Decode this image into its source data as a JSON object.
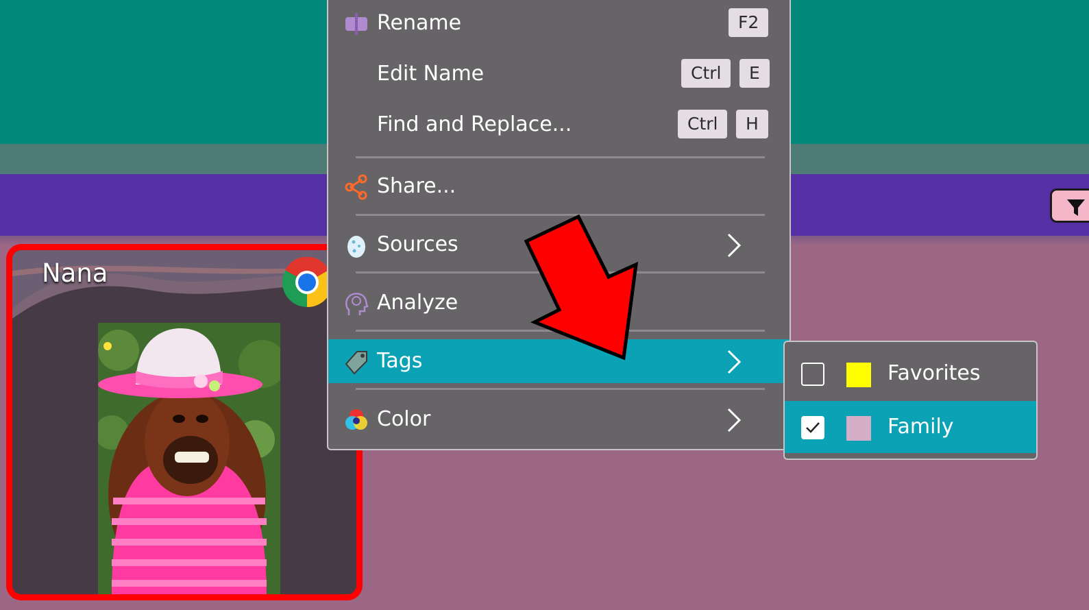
{
  "card": {
    "title": "Nana",
    "frame_color": "#ff0000",
    "browser_icon": "chrome-icon",
    "image": "orangutan-photo"
  },
  "toolbar": {
    "filter_icon": "filter-icon",
    "filter_button_color": "#f4b6c9"
  },
  "context_menu": {
    "items": [
      {
        "label": "Rename",
        "icon": "rename-icon",
        "shortcut": [
          "F2"
        ]
      },
      {
        "label": "Edit Name",
        "shortcut": [
          "Ctrl",
          "E"
        ]
      },
      {
        "label": "Find and Replace...",
        "shortcut": [
          "Ctrl",
          "H"
        ]
      },
      {
        "label": "Share...",
        "icon": "share-icon"
      },
      {
        "label": "Sources",
        "icon": "egg-icon",
        "submenu": true
      },
      {
        "label": "Analyze",
        "icon": "brain-icon"
      },
      {
        "label": "Tags",
        "icon": "tag-icon",
        "submenu": true,
        "highlighted": true
      },
      {
        "label": "Color",
        "icon": "color-wheel-icon",
        "submenu": true
      }
    ]
  },
  "tags_submenu": {
    "items": [
      {
        "label": "Favorites",
        "checked": false,
        "color": "#ffff00"
      },
      {
        "label": "Family",
        "checked": true,
        "color": "#d4aec6",
        "highlighted": true
      }
    ]
  },
  "colors": {
    "teal_band": "#02887a",
    "purple_band": "#5530a4",
    "background": "#9c6784",
    "menu_bg": "#676468",
    "highlight": "#0ca2b5",
    "annotation_arrow": "#ff0000"
  }
}
